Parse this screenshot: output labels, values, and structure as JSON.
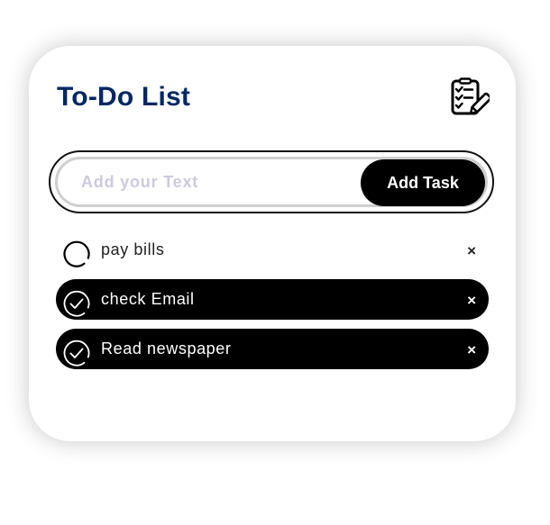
{
  "header": {
    "title": "To-Do List",
    "icon": "checklist-edit-icon",
    "title_color": "#002765"
  },
  "input": {
    "value": "",
    "placeholder": "Add your Text"
  },
  "add_button": {
    "label": "Add Task"
  },
  "tasks": [
    {
      "text": "pay bills",
      "checked": false,
      "remove_label": "×"
    },
    {
      "text": "check Email",
      "checked": true,
      "remove_label": "×"
    },
    {
      "text": "Read newspaper",
      "checked": true,
      "remove_label": "×"
    }
  ],
  "colors": {
    "done_background": "#000000",
    "button_background": "#000000",
    "placeholder": "#cfc9e0"
  }
}
